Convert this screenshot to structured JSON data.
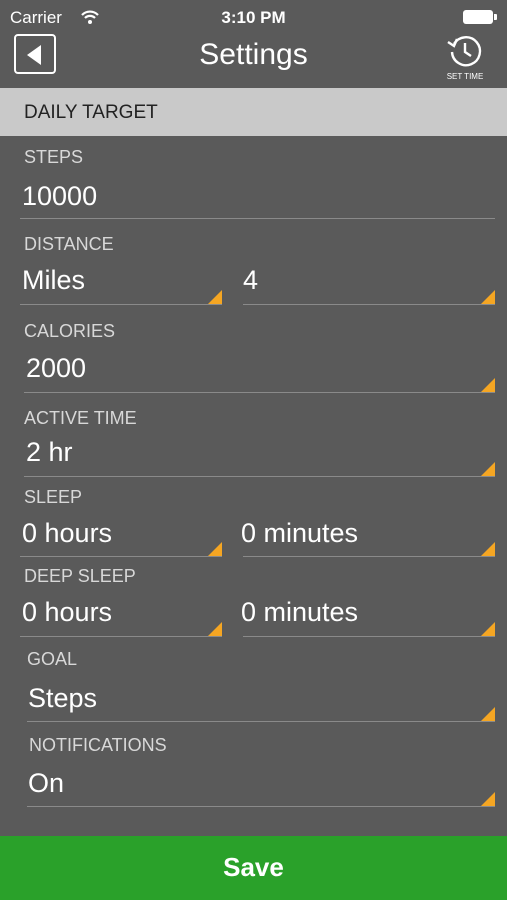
{
  "status": {
    "carrier": "Carrier",
    "time": "3:10 PM"
  },
  "nav": {
    "title": "Settings",
    "set_time_label": "SET TIME"
  },
  "section": {
    "title": "DAILY TARGET"
  },
  "fields": {
    "steps": {
      "label": "STEPS",
      "value": "10000"
    },
    "distance": {
      "label": "DISTANCE",
      "unit": "Miles",
      "value": "4"
    },
    "calories": {
      "label": "CALORIES",
      "value": "2000"
    },
    "active_time": {
      "label": "ACTIVE TIME",
      "value": "2 hr"
    },
    "sleep": {
      "label": "SLEEP",
      "hours": "0 hours",
      "minutes": "0 minutes"
    },
    "deep_sleep": {
      "label": "DEEP SLEEP",
      "hours": "0 hours",
      "minutes": "0 minutes"
    },
    "goal": {
      "label": "GOAL",
      "value": "Steps"
    },
    "notifications": {
      "label": "NOTIFICATIONS",
      "value": "On"
    }
  },
  "save": {
    "label": "Save"
  },
  "colors": {
    "accent": "#f5a623",
    "save_bar": "#2aa12a",
    "background": "#5a5a5a",
    "header": "#c9c9c9"
  }
}
